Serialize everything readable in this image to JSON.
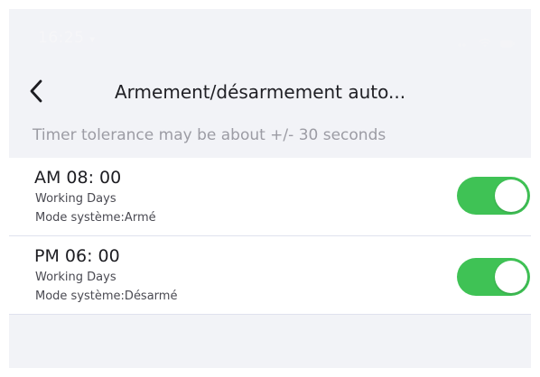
{
  "status_bar": {
    "time": "16:25",
    "time_suffix": "▾",
    "icons": [
      "signal-icon",
      "wifi-icon",
      "battery-icon"
    ]
  },
  "nav": {
    "back_icon": "chevron-left-icon",
    "title": "Armement/désarmement auto..."
  },
  "notice": "Timer tolerance may be about +/- 30 seconds",
  "schedules": [
    {
      "time": "AM  08: 00",
      "days": "Working Days",
      "mode": "Mode système:Armé",
      "enabled": true
    },
    {
      "time": "PM  06: 00",
      "days": "Working Days",
      "mode": "Mode système:Désarmé",
      "enabled": true
    }
  ],
  "colors": {
    "toggle_on": "#3fc255",
    "screen_background": "#f2f3f7",
    "row_background": "#ffffff",
    "divider": "#dfe2ee",
    "notice_text": "#9c9ca4",
    "status_bar_text": "#f6f6f8"
  }
}
